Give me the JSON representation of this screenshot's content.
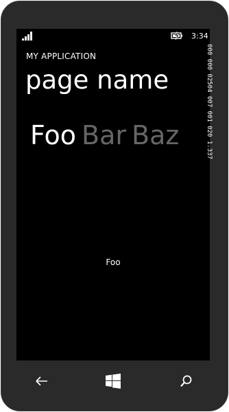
{
  "status_bar": {
    "time": "3:34",
    "signal_icon": "signal-bars-icon",
    "battery_icon": "battery-icon"
  },
  "app": {
    "title": "MY APPLICATION",
    "page_name": "page name"
  },
  "pivot": {
    "tabs": [
      {
        "label": "Foo",
        "active": true
      },
      {
        "label": "Bar",
        "active": false
      },
      {
        "label": "Baz",
        "active": false
      }
    ]
  },
  "content": {
    "text": "Foo"
  },
  "debug_counters": {
    "text": "000 000 02504 007 001 020 1.337"
  },
  "nav": {
    "back_icon": "back-arrow-icon",
    "home_icon": "windows-logo-icon",
    "search_icon": "search-icon"
  },
  "colors": {
    "screen_bg": "#000000",
    "bezel": "#2a2a2a",
    "active_text": "#ffffff",
    "inactive_text": "#666666"
  }
}
